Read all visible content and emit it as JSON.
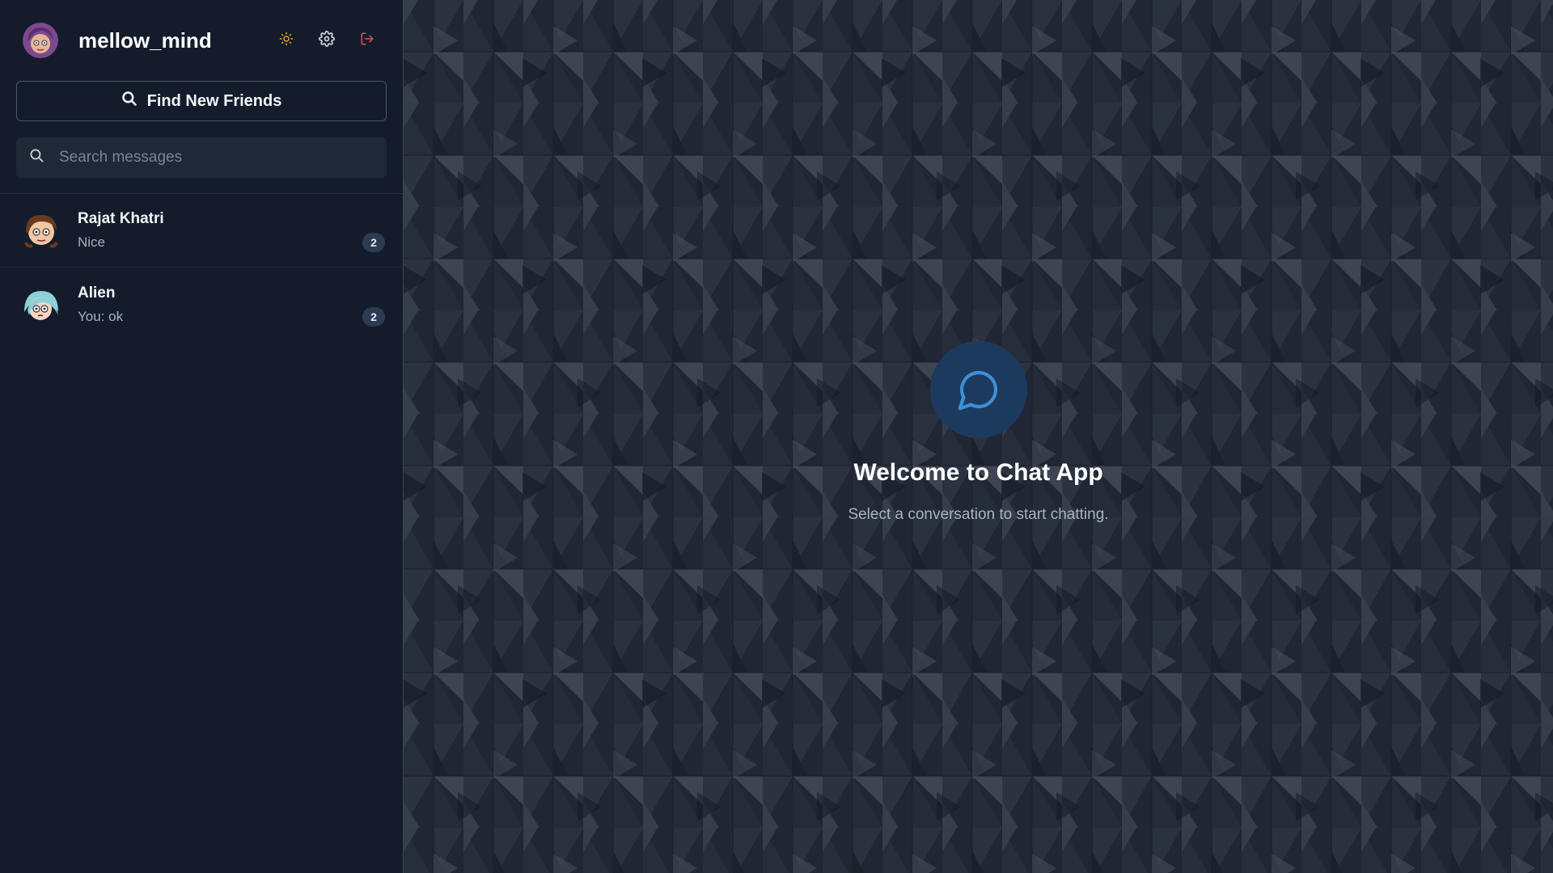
{
  "user": {
    "username": "mellow_mind"
  },
  "header": {
    "theme_icon": "sun-icon",
    "settings_icon": "gear-icon",
    "logout_icon": "logout-icon"
  },
  "find_friends": {
    "label": "Find New Friends",
    "icon": "search-icon"
  },
  "search": {
    "placeholder": "Search messages",
    "value": ""
  },
  "conversations": [
    {
      "name": "Rajat Khatri",
      "last_message": "Nice",
      "unread": "2"
    },
    {
      "name": "Alien",
      "last_message": "You: ok",
      "unread": "2"
    }
  ],
  "welcome": {
    "title": "Welcome to Chat App",
    "subtitle": "Select a conversation to start chatting.",
    "icon": "chat-bubble-icon"
  },
  "colors": {
    "sidebar_bg": "#141c2c",
    "main_bg": "#202633",
    "accent": "#3b82c6",
    "logout": "#e05252",
    "theme_icon": "#e0a020"
  }
}
